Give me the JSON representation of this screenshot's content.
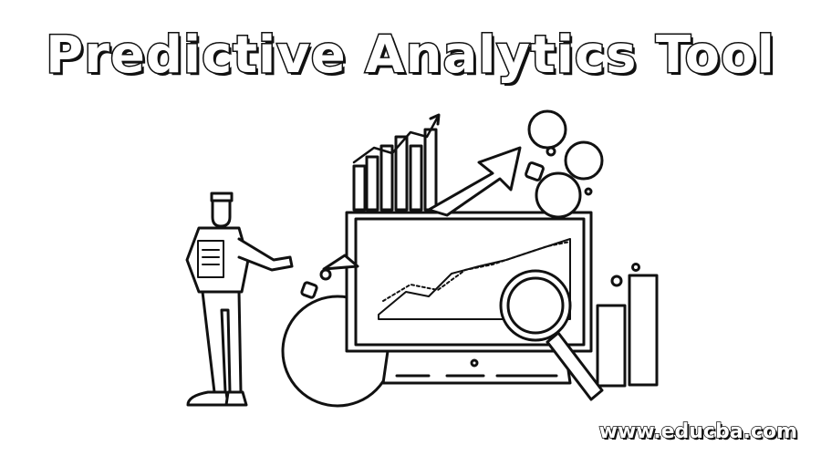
{
  "banner": {
    "title": "Predictive Analytics Tool",
    "watermark": "www.educba.com"
  },
  "illustration": {
    "subject": "person presenting analytics dashboard with rising bar chart, arrow, area chart and magnifying glass",
    "stroke_color": "#111111",
    "fill_color": "#ffffff"
  }
}
